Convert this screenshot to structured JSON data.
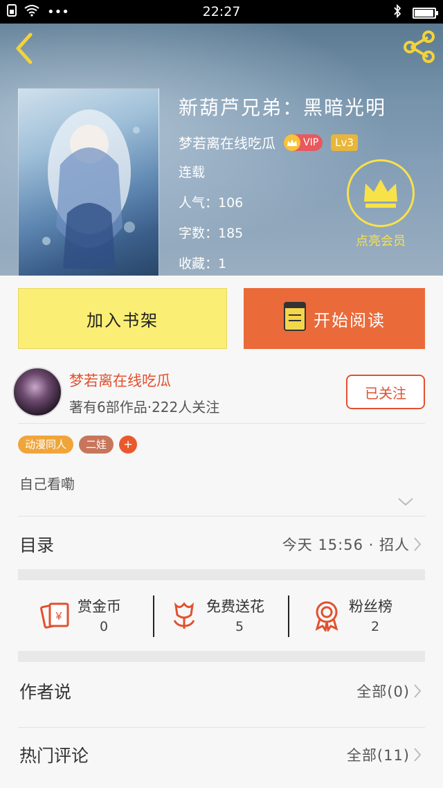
{
  "status_bar": {
    "time": "22:27",
    "dots": "•••",
    "battery_level_pct": 95
  },
  "book": {
    "title": "新葫芦兄弟：黑暗光明",
    "author": "梦若离在线吃瓜",
    "vip_label": "VIP",
    "level_label": "Lv3",
    "status": "连载",
    "popularity": "人气：106",
    "word_count": "字数：185",
    "favorites": "收藏：1"
  },
  "member": {
    "label": "点亮会员"
  },
  "actions": {
    "add_shelf": "加入书架",
    "start_read": "开始阅读"
  },
  "author_card": {
    "name": "梦若离在线吃瓜",
    "stats": "著有6部作品·222人关注",
    "follow": "已关注"
  },
  "tags": [
    "动漫同人",
    "二娃"
  ],
  "tag_add": "+",
  "description": "自己看嘞",
  "catalog": {
    "title": "目录",
    "update": "今天 15:56 · 招人"
  },
  "stats": [
    {
      "name": "赏金币",
      "value": "0",
      "icon": "red-envelope-yen-icon"
    },
    {
      "name": "免费送花",
      "value": "5",
      "icon": "flower-icon"
    },
    {
      "name": "粉丝榜",
      "value": "2",
      "icon": "medal-icon"
    }
  ],
  "author_says": {
    "title": "作者说",
    "link": "全部(0)"
  },
  "hot_comments": {
    "title": "热门评论",
    "link": "全部(11)"
  },
  "colors": {
    "accent_orange": "#ea6a3a",
    "shelf_yellow": "#fbee75",
    "author_red": "#e2502e",
    "member_yellow": "#f8e24a"
  }
}
